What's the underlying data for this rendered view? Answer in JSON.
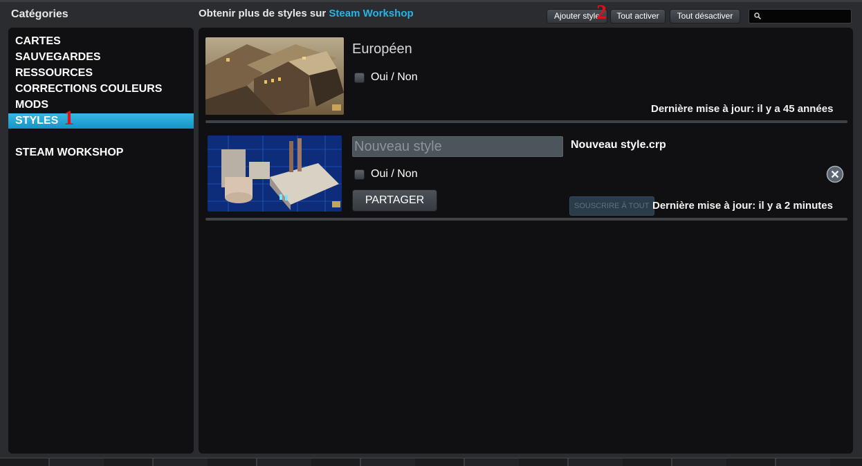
{
  "sidebar": {
    "title": "Catégories",
    "items": [
      {
        "label": "CARTES"
      },
      {
        "label": "SAUVEGARDES"
      },
      {
        "label": "RESSOURCES"
      },
      {
        "label": "CORRECTIONS COULEURS"
      },
      {
        "label": "MODS"
      },
      {
        "label": "STYLES",
        "active": true
      },
      {
        "label": "STEAM WORKSHOP"
      }
    ]
  },
  "header": {
    "workshop_prefix": "Obtenir plus de styles sur",
    "workshop_link": "Steam Workshop",
    "add_style": "Ajouter style",
    "enable_all": "Tout activer",
    "disable_all": "Tout désactiver",
    "search_icon": "search-icon"
  },
  "annotations": {
    "marker_1": "1",
    "marker_2": "2"
  },
  "styles": [
    {
      "name": "Européen",
      "toggle_label": "Oui / Non",
      "updated": "Dernière mise à jour: il y a 45 années"
    },
    {
      "name_placeholder": "Nouveau style",
      "filename": "Nouveau style.crp",
      "toggle_label": "Oui / Non",
      "share": "PARTAGER",
      "subscribe": "SOUSCRIRE À TOUT",
      "updated": "Dernière mise à jour: il y a 2 minutes",
      "close_icon": "close-icon"
    }
  ],
  "colors": {
    "accent": "#28b4e6",
    "active_tab": "#1e9fd2",
    "panel_bg": "#101012",
    "marker": "#e0101a"
  }
}
